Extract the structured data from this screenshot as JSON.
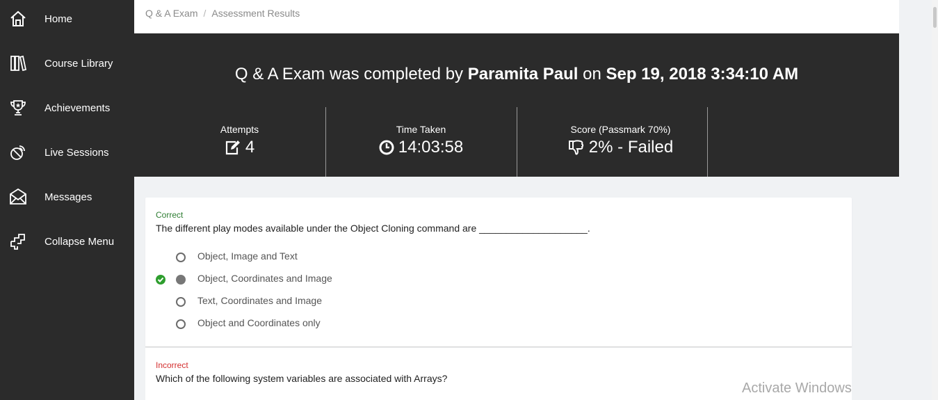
{
  "sidebar": {
    "items": [
      {
        "label": "Home",
        "icon": "home-icon"
      },
      {
        "label": "Course Library",
        "icon": "library-icon"
      },
      {
        "label": "Achievements",
        "icon": "trophy-icon"
      },
      {
        "label": "Live Sessions",
        "icon": "broadcast-icon"
      },
      {
        "label": "Messages",
        "icon": "envelope-icon"
      },
      {
        "label": "Collapse Menu",
        "icon": "collapse-icon"
      }
    ]
  },
  "breadcrumb": {
    "items": [
      "Q & A Exam",
      "Assessment Results"
    ],
    "separator": "/"
  },
  "hero": {
    "exam_name": "Q & A Exam",
    "completed_by_text": " was completed by ",
    "user": "Paramita Paul",
    "on_text": " on ",
    "date": "Sep 19, 2018 3:34:10 AM"
  },
  "stats": {
    "attempts": {
      "label": "Attempts",
      "value": "4",
      "icon": "edit-icon"
    },
    "time_taken": {
      "label": "Time Taken",
      "value": "14:03:58",
      "icon": "clock-icon"
    },
    "score": {
      "label": "Score (Passmark 70%)",
      "value": "2% - Failed",
      "icon": "thumbs-down-icon"
    }
  },
  "questions": [
    {
      "status": "Correct",
      "text": "The different play modes available under the Object Cloning command are ____________________.",
      "options": [
        "Object, Image and Text",
        "Object, Coordinates and Image",
        "Text, Coordinates and Image",
        "Object and Coordinates only"
      ],
      "selected_index": 1
    },
    {
      "status": "Incorrect",
      "text": "Which of the following system variables are associated with Arrays?"
    }
  ],
  "watermark": "Activate Windows",
  "colors": {
    "sidebar_bg": "#2b2b2b",
    "correct": "#2e7d32",
    "incorrect": "#d32f2f",
    "check_green": "#2e9e2e"
  }
}
